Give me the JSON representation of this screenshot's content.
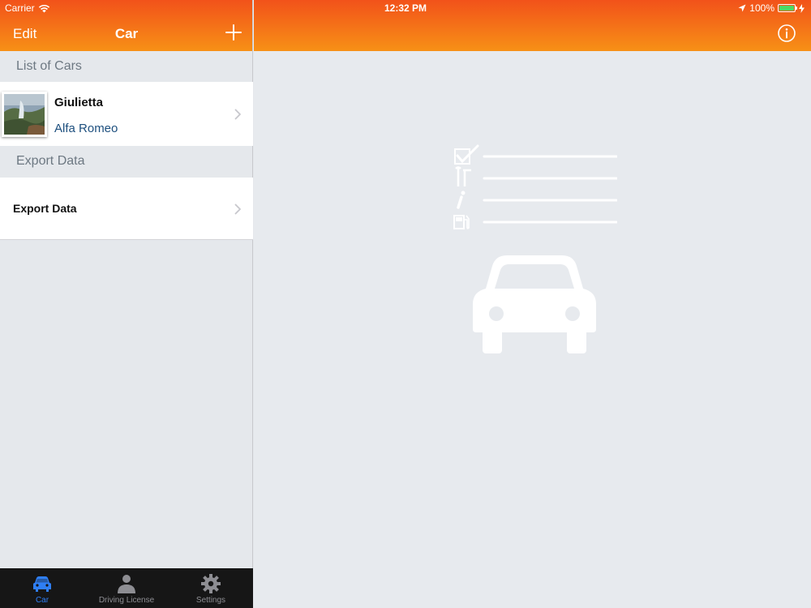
{
  "status_bar": {
    "carrier": "Carrier",
    "time": "12:32 PM",
    "battery": "100%"
  },
  "master_nav": {
    "edit_label": "Edit",
    "title": "Car",
    "add_icon": "plus-icon"
  },
  "detail_nav": {
    "info_icon": "info-circle-icon"
  },
  "sections": {
    "cars_header": "List of Cars",
    "export_header": "Export Data"
  },
  "cars": [
    {
      "name": "Giulietta",
      "make": "Alfa Romeo",
      "thumbnail_icon": "landscape-photo"
    }
  ],
  "export": {
    "label": "Export Data"
  },
  "tabs": [
    {
      "label": "Car",
      "icon": "car-icon",
      "active": true
    },
    {
      "label": "Driving License",
      "icon": "person-icon",
      "active": false
    },
    {
      "label": "Settings",
      "icon": "gear-icon",
      "active": false
    }
  ],
  "colors": {
    "nav_top": "#f2521a",
    "nav_bottom": "#f79016",
    "tab_active": "#2f7ff5",
    "tab_inactive": "#8e8e93",
    "make_text": "#1d4f7e"
  }
}
